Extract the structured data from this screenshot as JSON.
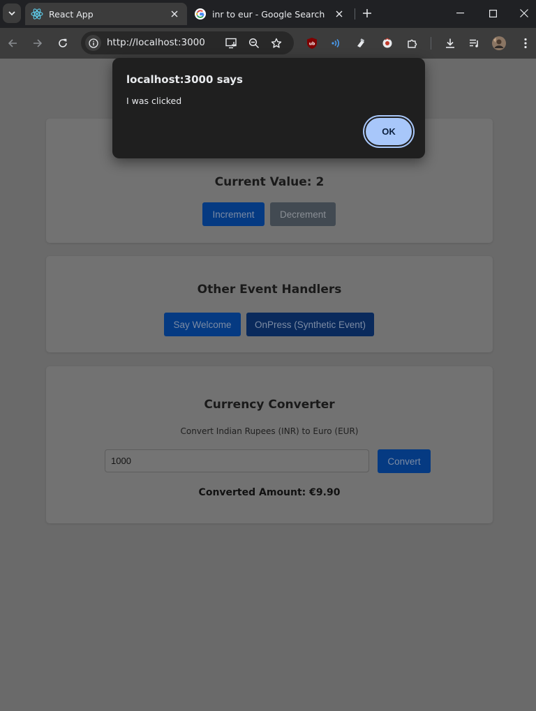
{
  "browser": {
    "tabs": [
      {
        "title": "React App",
        "favicon": "react-icon",
        "active": true
      },
      {
        "title": "inr to eur - Google Search",
        "favicon": "google-icon",
        "active": false
      }
    ],
    "address": "http://localhost:3000",
    "accent": "#a8c7fa"
  },
  "dialog": {
    "title": "localhost:3000 says",
    "message": "I was clicked",
    "ok_label": "OK"
  },
  "counter": {
    "heading": "Current Value: 2",
    "increment_label": "Increment",
    "decrement_label": "Decrement"
  },
  "events": {
    "heading": "Other Event Handlers",
    "welcome_label": "Say Welcome",
    "onpress_label": "OnPress (Synthetic Event)"
  },
  "converter": {
    "heading": "Currency Converter",
    "subtitle": "Convert Indian Rupees (INR) to Euro (EUR)",
    "input_value": "1000",
    "convert_label": "Convert",
    "result": "Converted Amount: €9.90"
  }
}
